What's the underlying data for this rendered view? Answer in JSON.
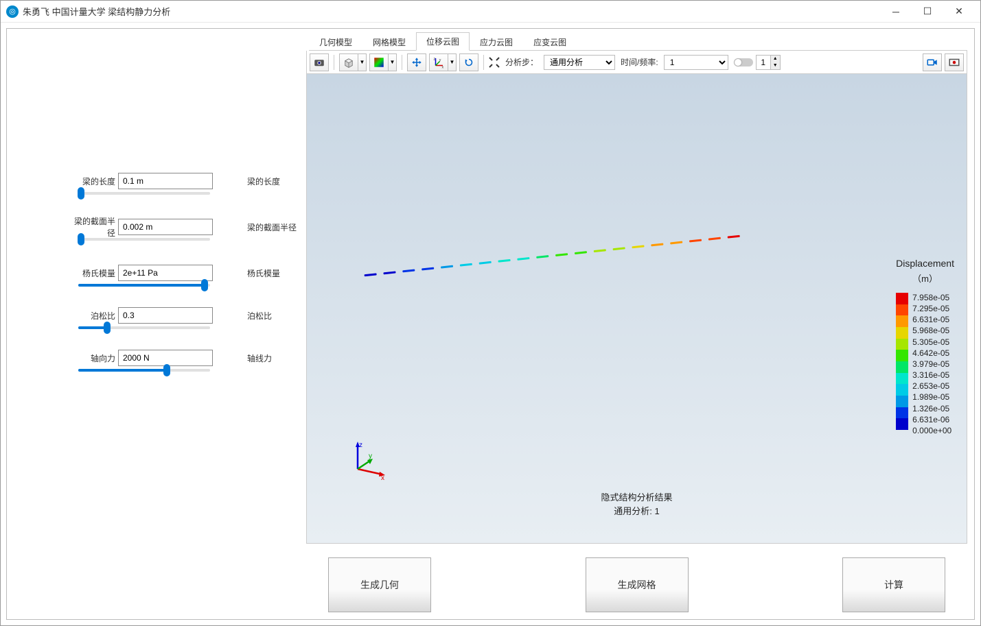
{
  "window": {
    "title": "朱勇飞 中国计量大学 梁结构静力分析"
  },
  "panel": {
    "params": [
      {
        "label": "梁的长度",
        "value": "0.1 m",
        "label2": "梁的长度",
        "slider_pct": 2
      },
      {
        "label": "梁的截面半径",
        "value": "0.002 m",
        "label2": "梁的截面半径",
        "slider_pct": 2
      },
      {
        "label": "杨氏模量",
        "value": "2e+11 Pa",
        "label2": "杨氏模量",
        "slider_pct": 96
      },
      {
        "label": "泊松比",
        "value": "0.3",
        "label2": "泊松比",
        "slider_pct": 22
      },
      {
        "label": "轴向力",
        "value": "2000 N",
        "label2": "轴线力",
        "slider_pct": 67
      }
    ]
  },
  "tabs": {
    "items": [
      {
        "label": "几何模型"
      },
      {
        "label": "网格模型"
      },
      {
        "label": "位移云图"
      },
      {
        "label": "应力云图"
      },
      {
        "label": "应变云图"
      }
    ],
    "active": 2
  },
  "toolbar": {
    "analysis_step_label": "分析步：",
    "analysis_step_value": "通用分析",
    "time_freq_label": "时间/频率:",
    "time_freq_value": "1",
    "spin_value": "1"
  },
  "viewer": {
    "result_line1": "隐式结构分析结果",
    "result_line2": "通用分析: 1",
    "legend_title": "Displacement",
    "legend_unit": "（m）",
    "legend_values": [
      "7.958e-05",
      "7.295e-05",
      "6.631e-05",
      "5.968e-05",
      "5.305e-05",
      "4.642e-05",
      "3.979e-05",
      "3.316e-05",
      "2.653e-05",
      "1.989e-05",
      "1.326e-05",
      "6.631e-06",
      "0.000e+00"
    ],
    "legend_colors": [
      "#e60000",
      "#ff4500",
      "#ff9900",
      "#e6d600",
      "#a6e600",
      "#33e600",
      "#00e666",
      "#00e6cc",
      "#00cce6",
      "#0099e6",
      "#0033e6",
      "#0000cc"
    ]
  },
  "actions": {
    "gen_geom": "生成几何",
    "gen_mesh": "生成网格",
    "compute": "计算"
  }
}
